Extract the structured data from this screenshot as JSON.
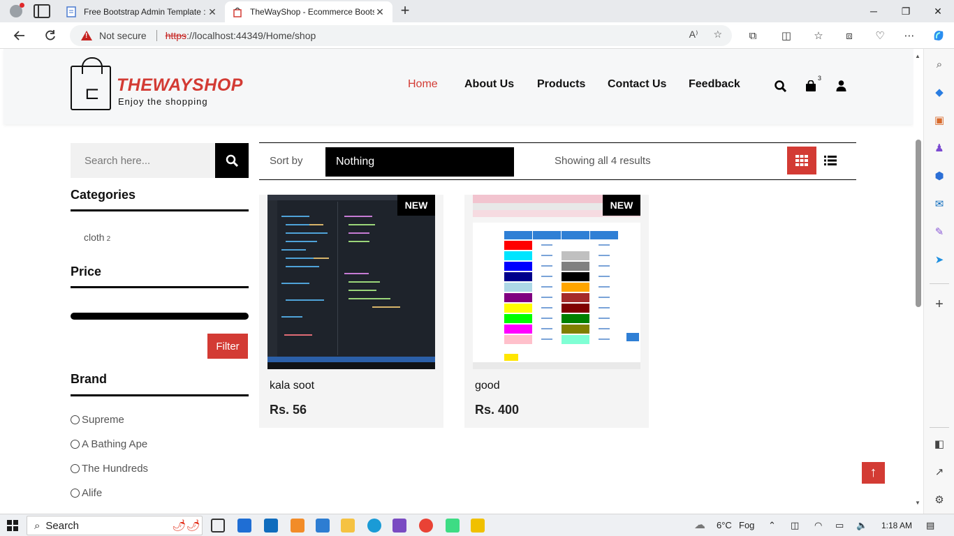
{
  "browser": {
    "tabs": [
      {
        "title": "Free Bootstrap Admin Template :",
        "active": false
      },
      {
        "title": "TheWayShop - Ecommerce Boots",
        "active": true
      }
    ],
    "security_label": "Not secure",
    "url_scheme": "https",
    "url_rest": "://localhost:44349/Home/shop",
    "new_tab_symbol": "+"
  },
  "header": {
    "logo_title": "THEWAYSHOP",
    "logo_tagline": "Enjoy the shopping",
    "nav": [
      "Home",
      "About Us",
      "Products",
      "Contact Us",
      "Feedback"
    ],
    "cart_count": "3"
  },
  "sidebar": {
    "search_placeholder": "Search here...",
    "categories_heading": "Categories",
    "categories": [
      {
        "name": "cloth",
        "count": "2"
      }
    ],
    "price_heading": "Price",
    "filter_label": "Filter",
    "brand_heading": "Brand",
    "brands": [
      "Supreme",
      "A Bathing Ape",
      "The Hundreds",
      "Alife"
    ]
  },
  "toolbar": {
    "sort_label": "Sort by",
    "sort_value": "Nothing",
    "results_text": "Showing all 4 results"
  },
  "products": [
    {
      "badge": "NEW",
      "name": "kala soot",
      "price": "Rs. 56"
    },
    {
      "badge": "NEW",
      "name": "good",
      "price": "Rs. 400"
    }
  ],
  "taskbar": {
    "search_label": "Search",
    "temperature": "6°C",
    "weather": "Fog",
    "time": "1:18 AM"
  },
  "colors": {
    "brand_red": "#d33b34",
    "black": "#000000",
    "card_bg": "#f4f4f4"
  }
}
